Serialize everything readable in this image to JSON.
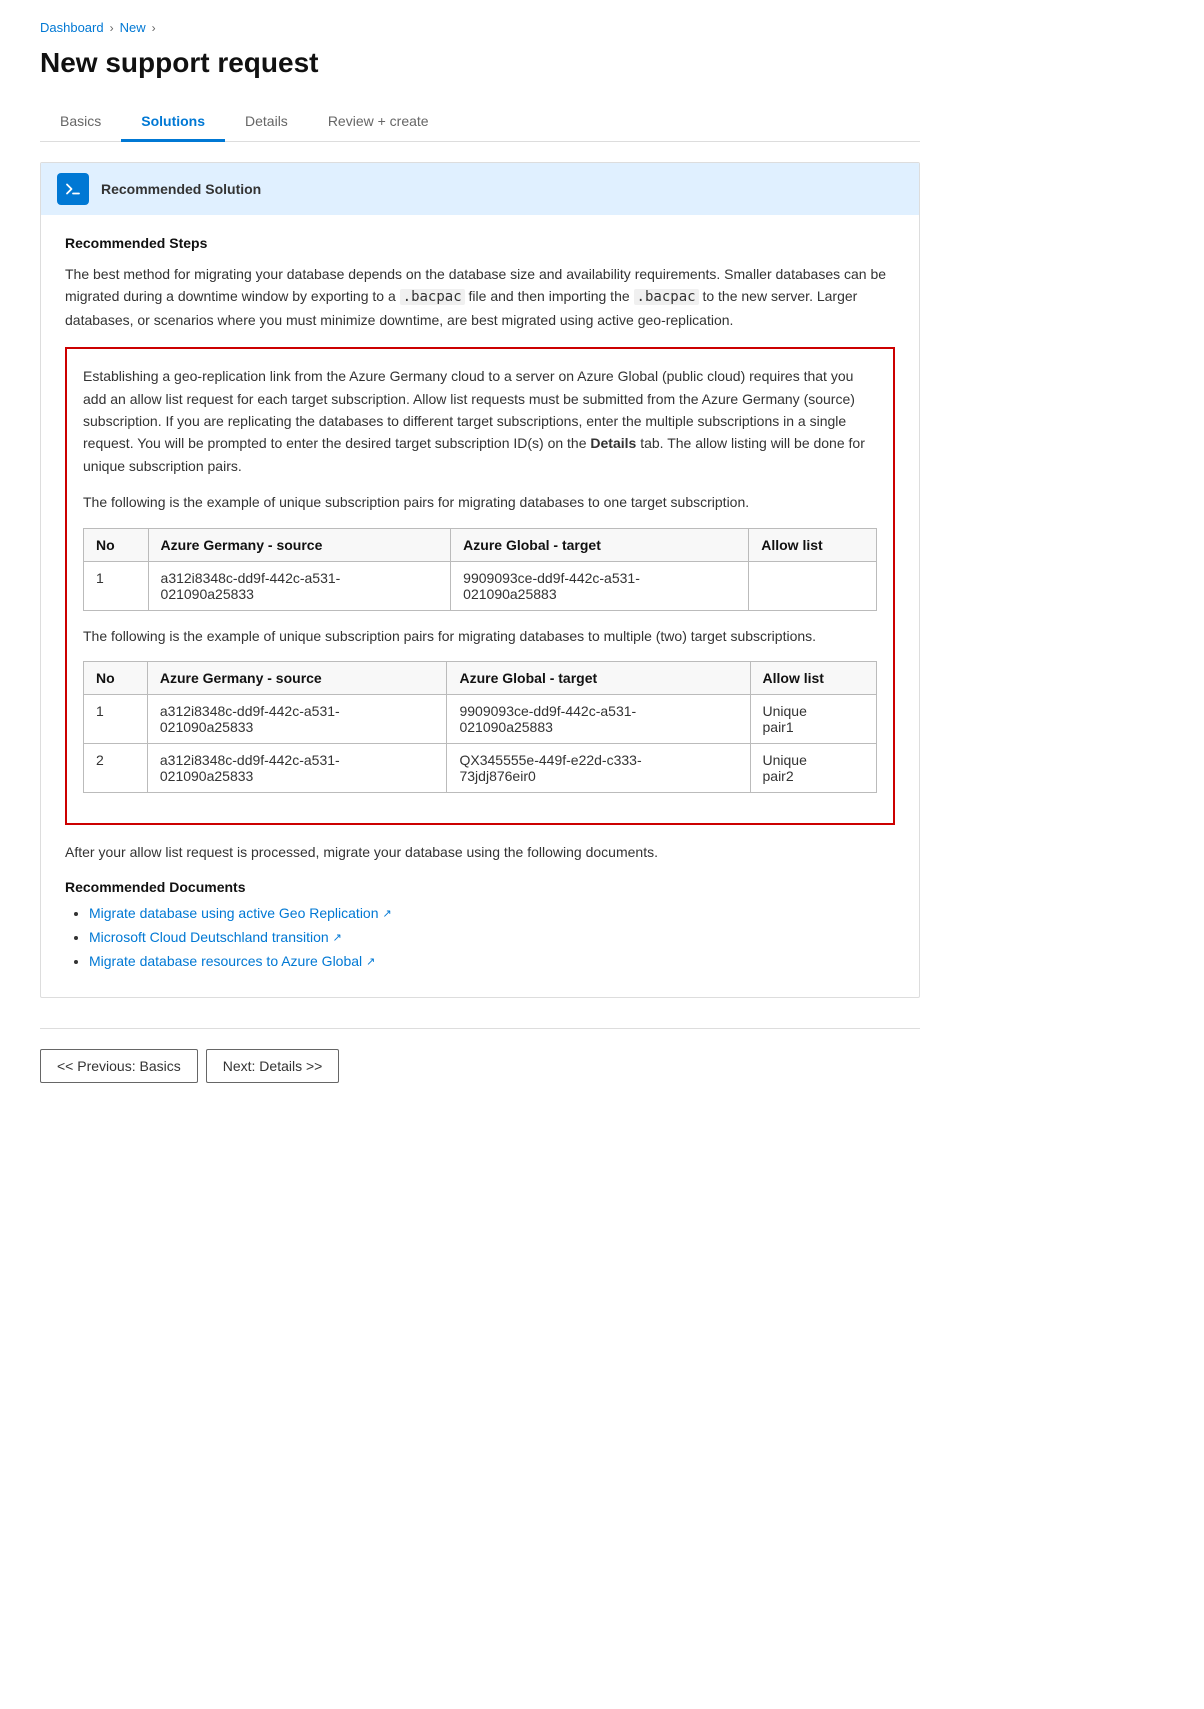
{
  "breadcrumb": {
    "items": [
      {
        "label": "Dashboard",
        "href": "#"
      },
      {
        "label": "New",
        "href": "#"
      }
    ]
  },
  "page_title": "New support request",
  "tabs": [
    {
      "label": "Basics",
      "id": "basics",
      "active": false
    },
    {
      "label": "Solutions",
      "id": "solutions",
      "active": true
    },
    {
      "label": "Details",
      "id": "details",
      "active": false
    },
    {
      "label": "Review + create",
      "id": "review-create",
      "active": false
    }
  ],
  "solution_header": {
    "title": "Recommended Solution"
  },
  "recommended_steps": {
    "title": "Recommended Steps",
    "intro_text": "The best method for migrating your database depends on the database size and availability requirements. Smaller databases can be migrated during a downtime window by exporting to a ",
    "bacpac1": ".bacpac",
    "mid_text": " file and then importing the ",
    "bacpac2": ".bacpac",
    "end_text": " to the new server. Larger databases, or scenarios where you must minimize downtime, are best migrated using active geo-replication."
  },
  "geo_replication_box": {
    "para1": "Establishing a geo-replication link from the Azure Germany cloud to a server on Azure Global (public cloud) requires that you add an allow list request for each target subscription. Allow list requests must be submitted from the Azure Germany (source) subscription. If you are replicating the databases to different target subscriptions, enter the multiple subscriptions in a single request. You will be prompted to enter the desired target subscription ID(s) on the ",
    "para1_bold": "Details",
    "para1_end": " tab. The allow listing will be done for unique subscription pairs.",
    "para2": "The following is the example of unique subscription pairs for migrating databases to one target subscription.",
    "table1": {
      "headers": [
        "No",
        "Azure Germany - source",
        "Azure Global - target",
        "Allow list"
      ],
      "rows": [
        {
          "no": "1",
          "source": "a312i8348c-dd9f-442c-a531-021090a25833",
          "target": "9909093ce-dd9f-442c-a531-021090a25883",
          "allow": ""
        }
      ]
    },
    "para3": "The following is the example of unique subscription pairs for migrating databases to multiple (two) target subscriptions.",
    "table2": {
      "headers": [
        "No",
        "Azure Germany - source",
        "Azure Global - target",
        "Allow list"
      ],
      "rows": [
        {
          "no": "1",
          "source": "a312i8348c-dd9f-442c-a531-021090a25833",
          "target": "9909093ce-dd9f-442c-a531-021090a25883",
          "allow": "Unique pair1"
        },
        {
          "no": "2",
          "source": "a312i8348c-dd9f-442c-a531-021090a25833",
          "target": "QX345555e-449f-e22d-c333-73jdj876eir0",
          "allow": "Unique pair2"
        }
      ]
    }
  },
  "after_allow_text": "After your allow list request is processed, migrate your database using the following documents.",
  "recommended_docs": {
    "title": "Recommended Documents",
    "links": [
      {
        "label": "Migrate database using active Geo Replication",
        "href": "#"
      },
      {
        "label": "Microsoft Cloud Deutschland transition",
        "href": "#"
      },
      {
        "label": "Migrate database resources to Azure Global",
        "href": "#"
      }
    ]
  },
  "footer": {
    "prev_button": "<< Previous: Basics",
    "next_button": "Next: Details >>"
  }
}
